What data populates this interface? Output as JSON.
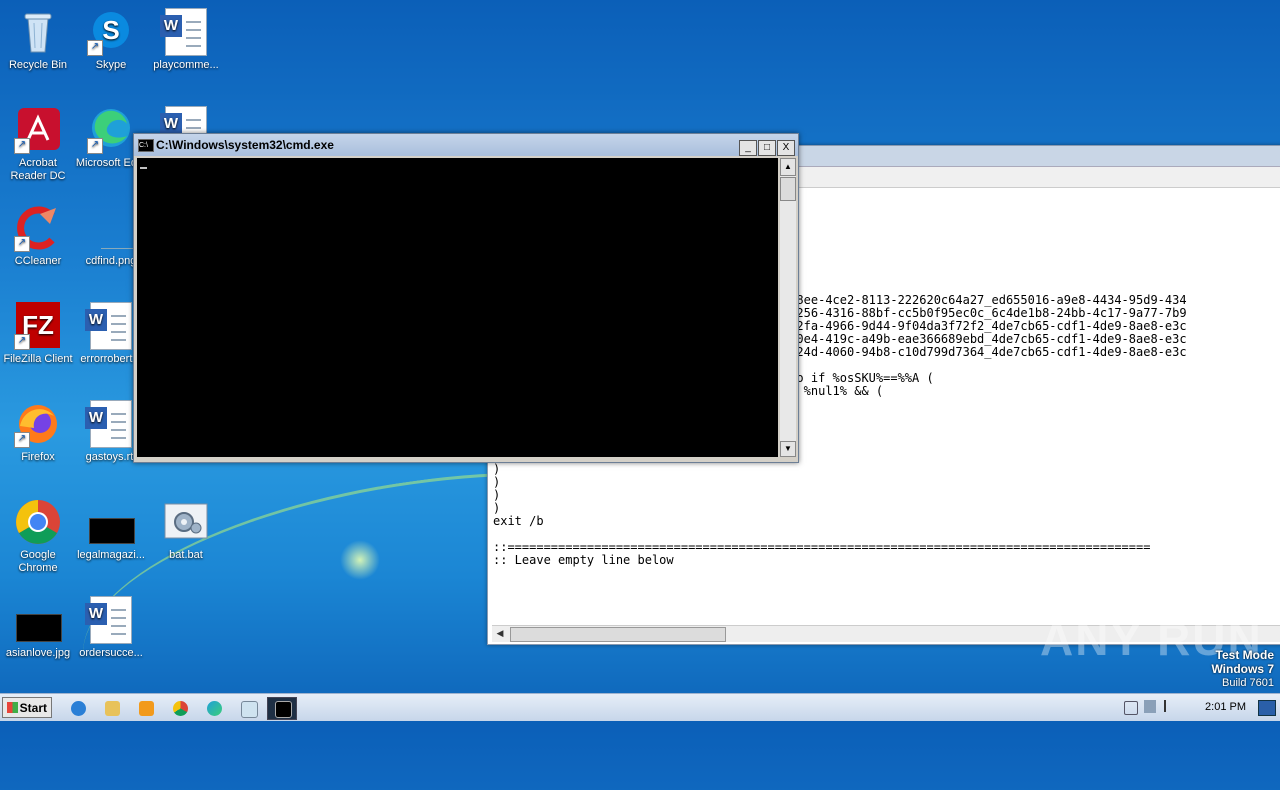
{
  "desktop": {
    "icons": [
      {
        "label": "Recycle Bin",
        "icon": "recycle-bin-icon"
      },
      {
        "label": "Skype",
        "icon": "skype-icon"
      },
      {
        "label": "playcomme...",
        "icon": "word-document-icon"
      },
      {
        "label": "Acrobat Reader DC",
        "icon": "acrobat-icon"
      },
      {
        "label": "Microsoft Ed...",
        "icon": "edge-icon"
      },
      {
        "label": "CCleaner",
        "icon": "ccleaner-icon"
      },
      {
        "label": "cdfind.png",
        "icon": "image-icon"
      },
      {
        "label": "FileZilla Client",
        "icon": "filezilla-icon"
      },
      {
        "label": "errorrobert...",
        "icon": "word-document-icon"
      },
      {
        "label": "Firefox",
        "icon": "firefox-icon"
      },
      {
        "label": "gastoys.rtf",
        "icon": "word-document-icon"
      },
      {
        "label": "Google Chrome",
        "icon": "chrome-icon"
      },
      {
        "label": "legalmagazi...",
        "icon": "image-icon"
      },
      {
        "label": "bat.bat",
        "icon": "batch-file-icon"
      },
      {
        "label": "asianlove.jpg",
        "icon": "image-icon"
      },
      {
        "label": "ordersucce...",
        "icon": "word-document-icon"
      }
    ]
  },
  "cmd_window": {
    "title": "C:\\Windows\\system32\\cmd.exe",
    "icon_label": "C:\\",
    "minimize": "_",
    "maximize": "□",
    "close": "X",
    "scroll_up": "▲",
    "scroll_down": "▼"
  },
  "notepad_text": "                                   9d2de-98ee-4ce2-8113-222620c64a27_ed655016-a9e8-4434-95d9-434\n                                   29426-a256-4316-88bf-cc5b0f95ec0c_6c4de1b8-24bb-4c17-9a77-7b9\n                                   938aa-62fa-4966-9d44-9f04da3f72f2_4de7cb65-cdf1-4de9-8ae8-e3c\n                                   f7d09-40e4-419c-a49b-eae366689ebd_4de7cb65-cdf1-4de9-8ae8-e3c\n                                   b852c-424d-4060-94b8-c10d799d7364_4de7cb65-cdf1-4de9-8ae8-e3c\n\n                                   %%#\") do if %osSKU%==%%A (\n                                   i \"%%C\" %nul1% && (\n                                   % && (\n\n\nset altedition=%%F\nset notfoundaltactID=1\n)\n)\n)\n)\nexit /b\n\n::=========================================================================================\n:: Leave empty line below",
  "watermark": "ANY RUN",
  "test_mode": {
    "line1": "Test Mode",
    "line2": "Windows 7",
    "line3": "Build 7601"
  },
  "taskbar": {
    "start_label": "Start",
    "clock": "2:01 PM",
    "items": [
      "internet-explorer-icon",
      "explorer-icon",
      "media-player-icon",
      "chrome-icon",
      "edge-icon",
      "notepad-icon",
      "cmd-icon"
    ]
  },
  "colors": {
    "desktop_top": "#0b5fb8",
    "desktop_mid": "#2a9ae0",
    "console_bg": "#000000",
    "title_bar": "#a9bfdc"
  }
}
